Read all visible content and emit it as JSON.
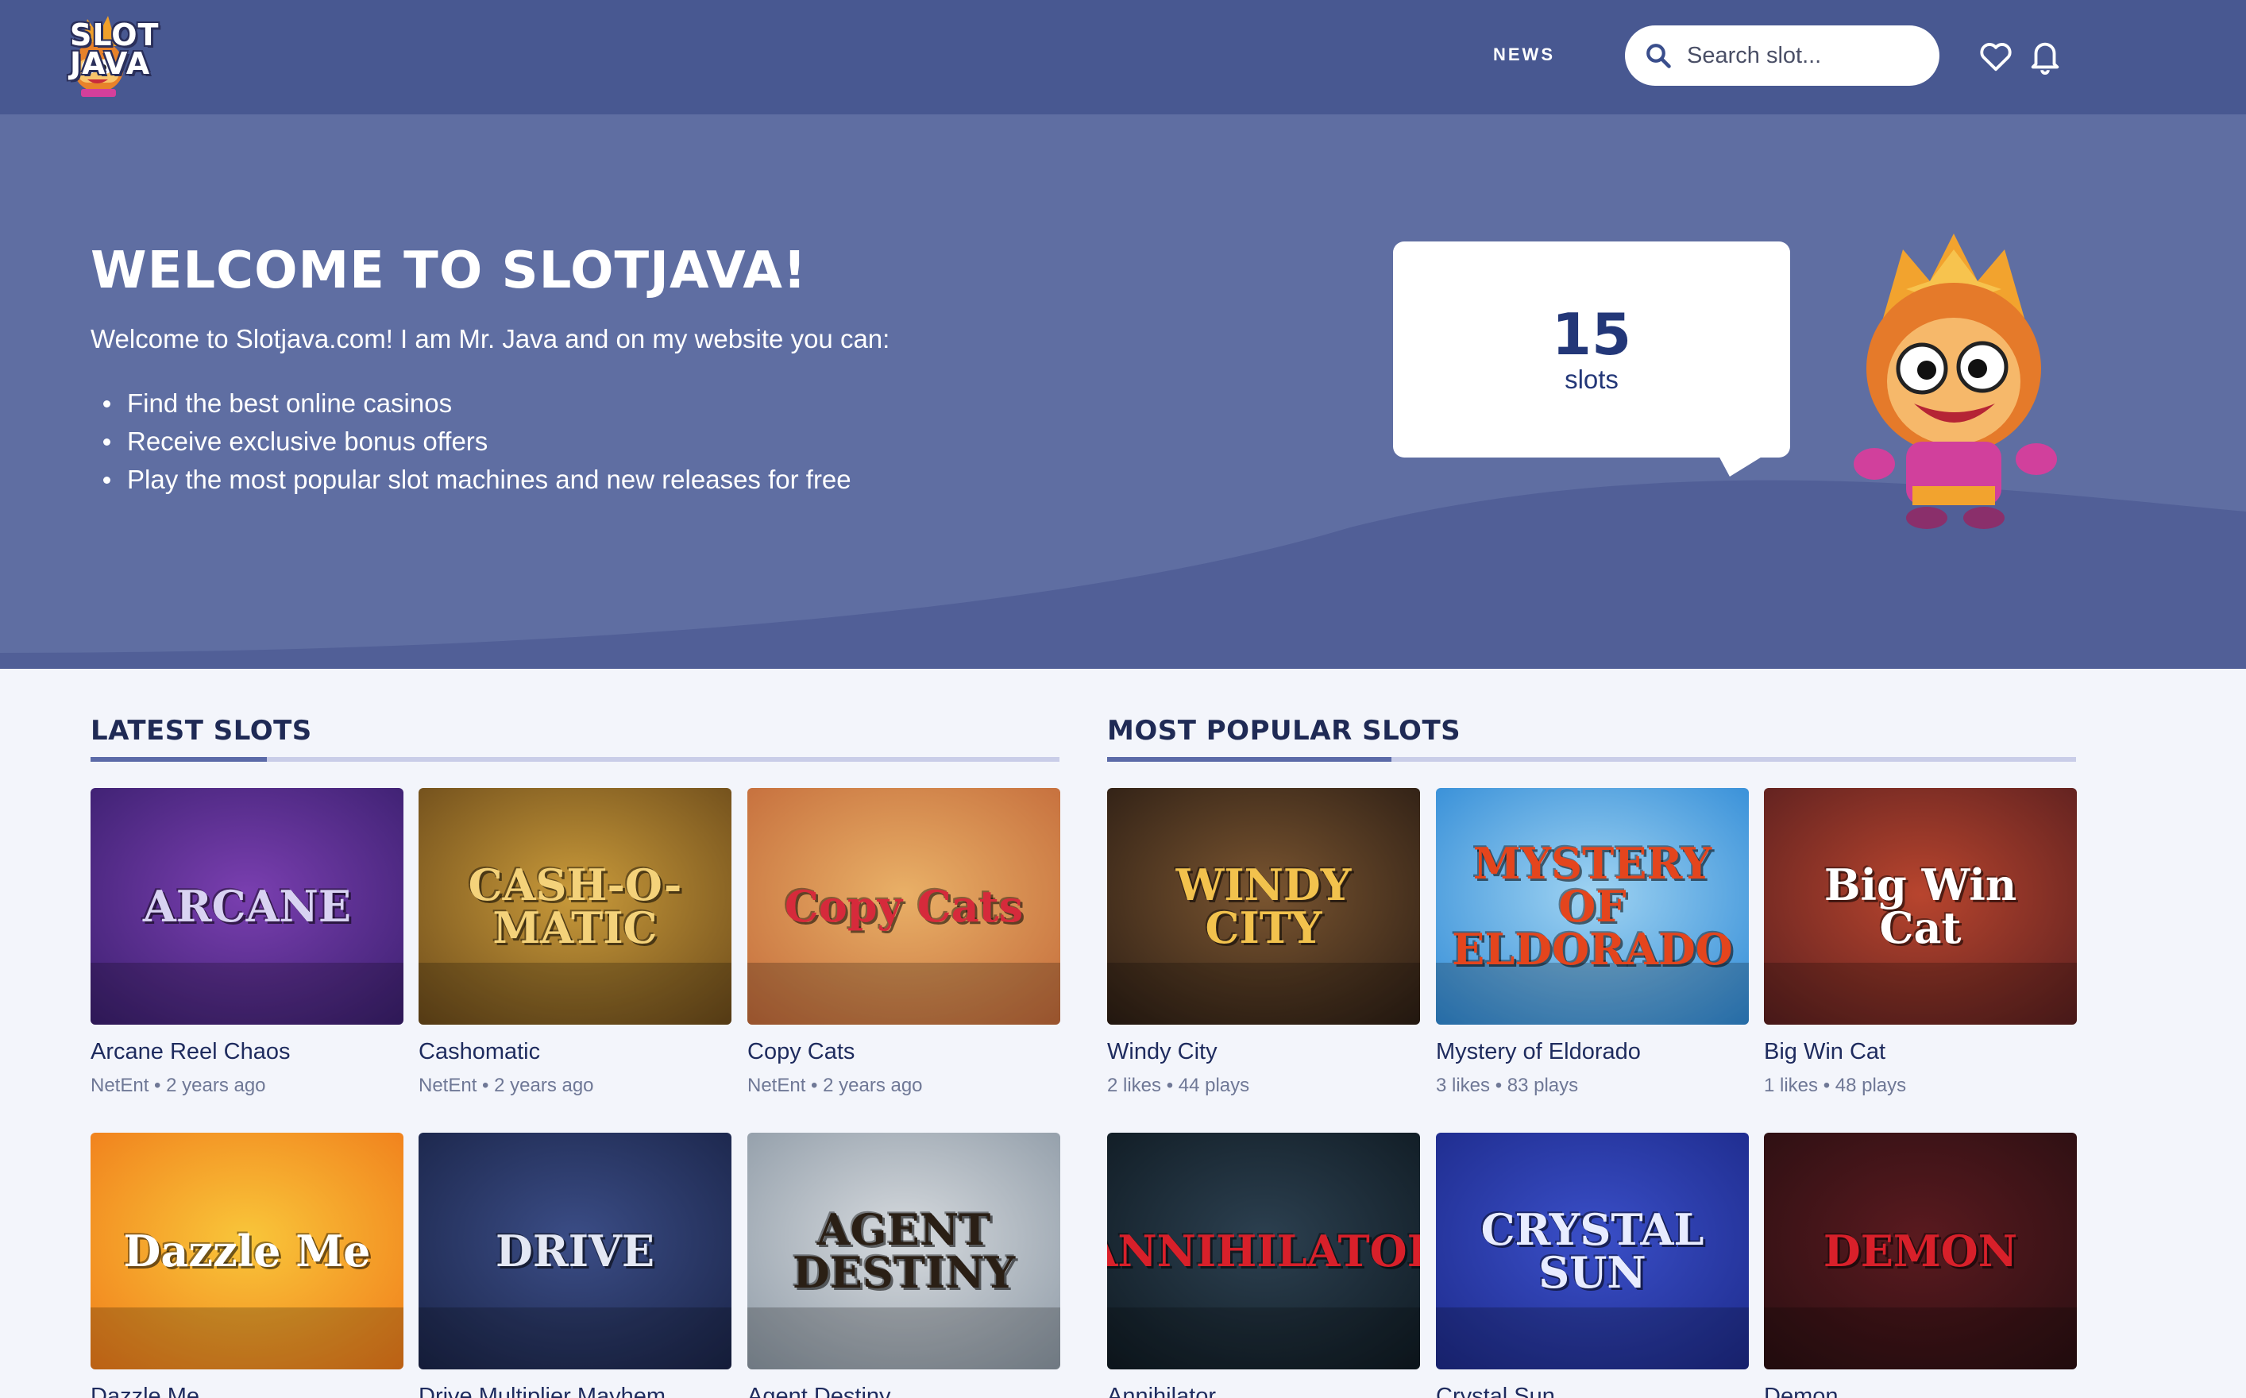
{
  "header": {
    "logo_line1": "SLOT",
    "logo_line2": "JAVA",
    "nav_news": "NEWS",
    "search_placeholder": "Search slot...",
    "icons": [
      "search-icon",
      "heart-icon",
      "bell-icon"
    ]
  },
  "hero": {
    "title": "WELCOME TO SLOTJAVA!",
    "intro": "Welcome to Slotjava.com! I am Mr. Java and on my website you can:",
    "bullets": [
      "Find the best online casinos",
      "Receive exclusive bonus offers",
      "Play the most popular slot machines and new releases for free"
    ],
    "slot_count": "15",
    "slot_count_label": "slots"
  },
  "latest": {
    "title": "LATEST SLOTS",
    "cards": [
      {
        "name": "Arcane Reel Chaos",
        "meta": "NetEnt • 2 years ago",
        "art": "ARCANE",
        "colors": [
          "#3a1f6e",
          "#7a3fb0"
        ],
        "text_color": "#d9d3f2"
      },
      {
        "name": "Cashomatic",
        "meta": "NetEnt • 2 years ago",
        "art": "CASH-O-MATIC",
        "colors": [
          "#6b4a1a",
          "#c99a3a"
        ],
        "text_color": "#f4d27a"
      },
      {
        "name": "Copy Cats",
        "meta": "NetEnt • 2 years ago",
        "art": "Copy Cats",
        "colors": [
          "#c36a3a",
          "#e9b067"
        ],
        "text_color": "#d62a3b"
      },
      {
        "name": "Dazzle Me",
        "meta": "",
        "art": "Dazzle Me",
        "colors": [
          "#f07b1a",
          "#f9c63a"
        ],
        "text_color": "#ffffff"
      },
      {
        "name": "Drive Multiplier Mayhem",
        "meta": "",
        "art": "DRIVE",
        "colors": [
          "#1a2448",
          "#3b4d86"
        ],
        "text_color": "#e4e8f4"
      },
      {
        "name": "Agent Destiny",
        "meta": "",
        "art": "AGENT DESTINY",
        "colors": [
          "#8e9aa6",
          "#d6dade"
        ],
        "text_color": "#2a1f15"
      }
    ]
  },
  "popular": {
    "title": "MOST POPULAR SLOTS",
    "cards": [
      {
        "name": "Windy City",
        "meta": "2 likes • 44 plays",
        "art": "WINDY CITY",
        "colors": [
          "#2b1d14",
          "#7a5530"
        ],
        "text_color": "#f2c24d"
      },
      {
        "name": "Mystery of Eldorado",
        "meta": "3 likes • 83 plays",
        "art": "MYSTERY OF ELDORADO",
        "colors": [
          "#2f8ad6",
          "#9fd3f2"
        ],
        "text_color": "#e4451d"
      },
      {
        "name": "Big Win Cat",
        "meta": "1 likes • 48 plays",
        "art": "Big Win Cat",
        "colors": [
          "#5a1f1f",
          "#b8452e"
        ],
        "text_color": "#ffffff"
      },
      {
        "name": "Annihilator",
        "meta": "",
        "art": "ANNIHILATOR",
        "colors": [
          "#0f1a22",
          "#2c4050"
        ],
        "text_color": "#d8202a"
      },
      {
        "name": "Crystal Sun",
        "meta": "",
        "art": "CRYSTAL SUN",
        "colors": [
          "#1d2a8a",
          "#3a4fc8"
        ],
        "text_color": "#e8ecff"
      },
      {
        "name": "Demon",
        "meta": "",
        "art": "DEMON",
        "colors": [
          "#2a0f12",
          "#5a1a1f"
        ],
        "text_color": "#d8202a"
      }
    ]
  }
}
